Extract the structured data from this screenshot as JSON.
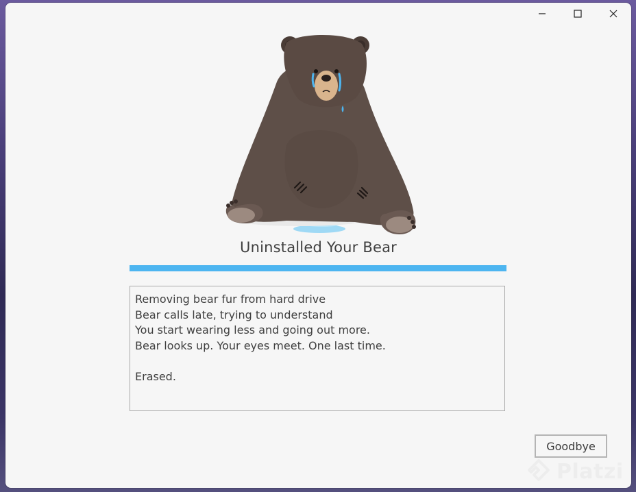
{
  "window": {
    "controls": {
      "minimize_icon": "minimize-icon",
      "maximize_icon": "maximize-icon",
      "close_icon": "close-icon"
    }
  },
  "illustration": {
    "icon": "crying-bear"
  },
  "title": "Uninstalled Your Bear",
  "progress": {
    "value_percent": 100,
    "color": "#4db5f0"
  },
  "log": {
    "lines": [
      "Removing bear fur from hard drive",
      "Bear calls late, trying to understand",
      "You start wearing less and going out more.",
      "Bear looks up. Your eyes meet. One last time."
    ],
    "final_line": "Erased."
  },
  "actions": {
    "goodbye_label": "Goodbye"
  },
  "watermark": {
    "text": "Platzi"
  }
}
